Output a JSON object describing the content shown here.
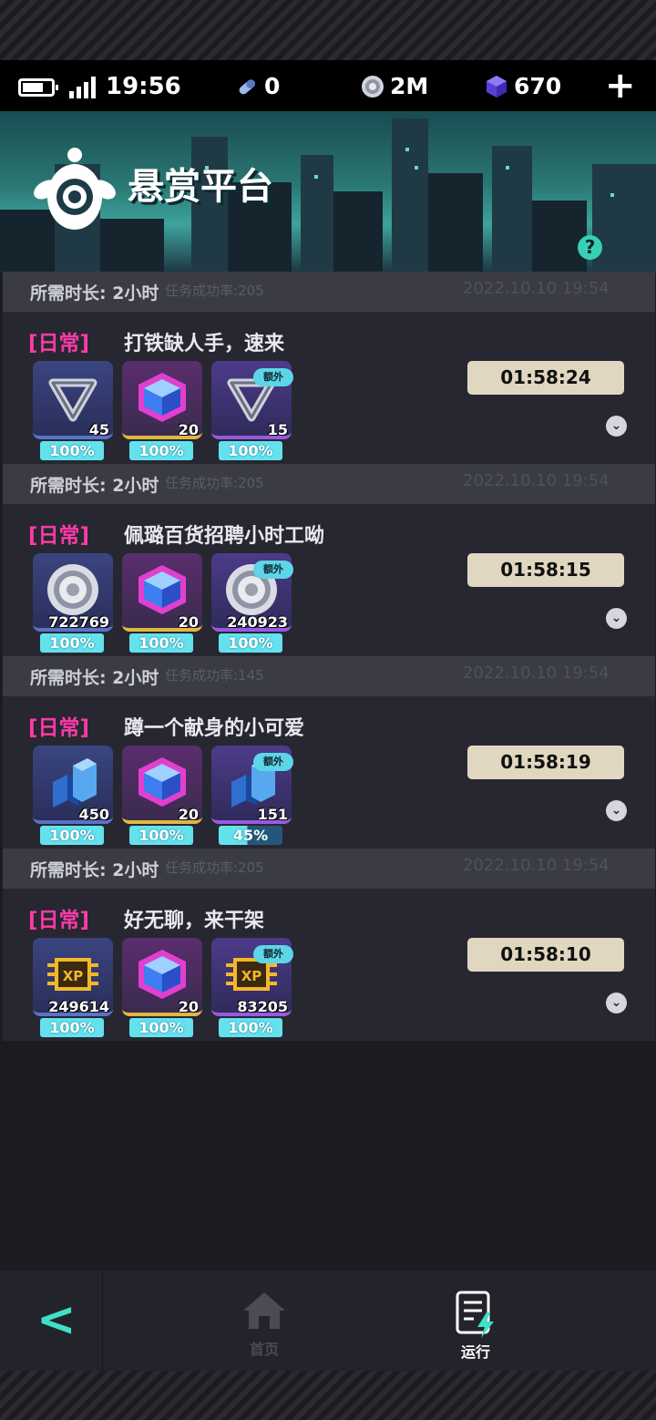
{
  "status_bar": {
    "time": "19:56",
    "resources": [
      {
        "icon": "pill-icon",
        "value": "0"
      },
      {
        "icon": "coin-icon",
        "value": "2M"
      },
      {
        "icon": "gem-cube-icon",
        "value": "670"
      }
    ],
    "add_label": "+"
  },
  "banner": {
    "title": "悬赏平台",
    "help_label": "?"
  },
  "tasks": [
    {
      "duration": "所需时长: 2小时",
      "success_rate": "任务成功率:205",
      "date": "2022.10.10 19:54",
      "tag": "[日常]",
      "title": "打铁缺人手，速来",
      "timer": "01:58:24",
      "rewards": [
        {
          "icon": "mobius-ring-icon",
          "count": "45",
          "percent": "100%"
        },
        {
          "icon": "gem-cube-icon",
          "count": "20",
          "percent": "100%"
        },
        {
          "icon": "mobius-ring-icon",
          "count": "15",
          "percent": "100%",
          "extra": "额外"
        }
      ]
    },
    {
      "duration": "所需时长: 2小时",
      "success_rate": "任务成功率:205",
      "date": "2022.10.10 19:54",
      "tag": "[日常]",
      "title": "佩璐百货招聘小时工呦",
      "timer": "01:58:15",
      "rewards": [
        {
          "icon": "coin-icon",
          "count": "722769",
          "percent": "100%"
        },
        {
          "icon": "gem-cube-icon",
          "count": "20",
          "percent": "100%"
        },
        {
          "icon": "coin-icon",
          "count": "240923",
          "percent": "100%",
          "extra": "额外"
        }
      ]
    },
    {
      "duration": "所需时长: 2小时",
      "success_rate": "任务成功率:145",
      "date": "2022.10.10 19:54",
      "tag": "[日常]",
      "title": "蹲一个献身的小可爱",
      "timer": "01:58:19",
      "rewards": [
        {
          "icon": "blocks-icon",
          "count": "450",
          "percent": "100%"
        },
        {
          "icon": "gem-cube-icon",
          "count": "20",
          "percent": "100%"
        },
        {
          "icon": "blocks-icon",
          "count": "151",
          "percent": "45%",
          "extra": "额外"
        }
      ]
    },
    {
      "duration": "所需时长: 2小时",
      "success_rate": "任务成功率:205",
      "date": "2022.10.10 19:54",
      "tag": "[日常]",
      "title": "好无聊，来干架",
      "timer": "01:58:10",
      "rewards": [
        {
          "icon": "xp-chip-icon",
          "count": "249614",
          "percent": "100%"
        },
        {
          "icon": "gem-cube-icon",
          "count": "20",
          "percent": "100%"
        },
        {
          "icon": "xp-chip-icon",
          "count": "83205",
          "percent": "100%",
          "extra": "额外"
        }
      ]
    }
  ],
  "nav": {
    "home_label": "首页",
    "run_label": "运行"
  },
  "colors": {
    "accent": "#3fe0c6",
    "tag": "#ff3aa8",
    "progress": "#63e2ee",
    "timer_bg": "#e1d6c0"
  }
}
